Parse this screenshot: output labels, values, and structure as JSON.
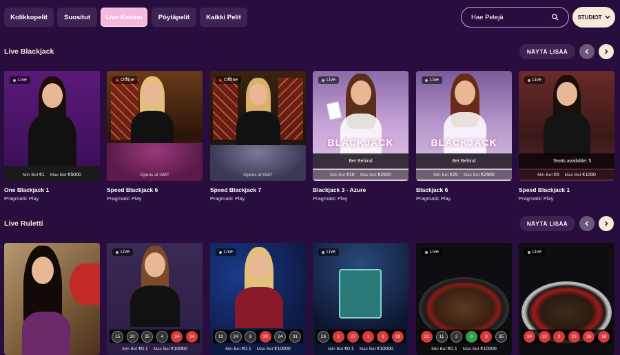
{
  "tabs": [
    "Kolikkopelit",
    "Suositut",
    "Live Kasino",
    "Pöytäpelit",
    "Kaikki Pelit"
  ],
  "search": {
    "placeholder": "Hae Pelejä"
  },
  "studios_label": "STUDIOT",
  "sections": [
    {
      "title": "Live Blackjack",
      "show_more": "NÄYTÄ LISÄÄ",
      "cards": [
        {
          "title": "One Blackjack 1",
          "provider": "Pragmatic Play",
          "status": "Live",
          "overlay": "",
          "min": "€1",
          "max": "€5000",
          "extra": ""
        },
        {
          "title": "Speed Blackjack 6",
          "provider": "Pragmatic Play",
          "status": "Offline",
          "overlay": "",
          "min": "",
          "max": "",
          "extra": "Opens at GMT"
        },
        {
          "title": "Speed Blackjack 7",
          "provider": "Pragmatic Play",
          "status": "Offline",
          "overlay": "",
          "min": "",
          "max": "",
          "extra": "Opens at GMT"
        },
        {
          "title": "Blackjack 3 - Azure",
          "provider": "Pragmatic Play",
          "status": "Live",
          "overlay": "Bet Behind",
          "min": "€10",
          "max": "€2500",
          "extra": ""
        },
        {
          "title": "Blackjack 6",
          "provider": "Pragmatic Play",
          "status": "Live",
          "overlay": "Bet Behind",
          "min": "€25",
          "max": "€2500",
          "extra": ""
        },
        {
          "title": "Speed Blackjack 1",
          "provider": "Pragmatic Play",
          "status": "Live",
          "overlay": "Seats available: 5",
          "min": "€5",
          "max": "€1000",
          "extra": ""
        }
      ]
    },
    {
      "title": "Live Ruletti",
      "show_more": "NÄYTÄ LISÄÄ",
      "cards": [
        {
          "status": "",
          "numbers": [],
          "min": "",
          "max": ""
        },
        {
          "status": "Live",
          "numbers": [
            [
              "15",
              "black"
            ],
            [
              "20",
              "black"
            ],
            [
              "35",
              "black"
            ],
            [
              "4",
              "black"
            ],
            [
              "34",
              "red"
            ],
            [
              "34",
              "red"
            ]
          ],
          "min": "€0.1",
          "max": "€10000"
        },
        {
          "status": "Live",
          "numbers": [
            [
              "10",
              "black"
            ],
            [
              "24",
              "black"
            ],
            [
              "8",
              "black"
            ],
            [
              "30",
              "red"
            ],
            [
              "24",
              "black"
            ],
            [
              "31",
              "black"
            ]
          ],
          "min": "€0.1",
          "max": "€10000"
        },
        {
          "status": "Live",
          "numbers": [
            [
              "26",
              "black"
            ],
            [
              "1",
              "red"
            ],
            [
              "27",
              "red"
            ],
            [
              "1",
              "red"
            ],
            [
              "9",
              "red"
            ],
            [
              "19",
              "red"
            ]
          ],
          "min": "€0.1",
          "max": "€10000"
        },
        {
          "status": "Live",
          "numbers": [
            [
              "21",
              "red"
            ],
            [
              "11",
              "black"
            ],
            [
              "2",
              "black"
            ],
            [
              "0",
              "green"
            ],
            [
              "3",
              "red"
            ],
            [
              "35",
              "black"
            ]
          ],
          "min": "€0.1",
          "max": "€10000"
        },
        {
          "status": "Live",
          "numbers": [
            [
              "34",
              "red"
            ],
            [
              "19",
              "red"
            ],
            [
              "9",
              "red"
            ],
            [
              "23",
              "red"
            ],
            [
              "36",
              "red"
            ],
            [
              "18",
              "red"
            ]
          ],
          "min": "",
          "max": ""
        }
      ]
    }
  ],
  "limit_labels": {
    "min": "Min Bet",
    "max": "Max Bet"
  },
  "colors": {
    "bg": "#2a0d3f",
    "tab": "#3e2254",
    "active_tab": "#f6b9dc",
    "accent_text": "#fbe0c8",
    "red": "#d83a3a",
    "green": "#2fa14a"
  }
}
